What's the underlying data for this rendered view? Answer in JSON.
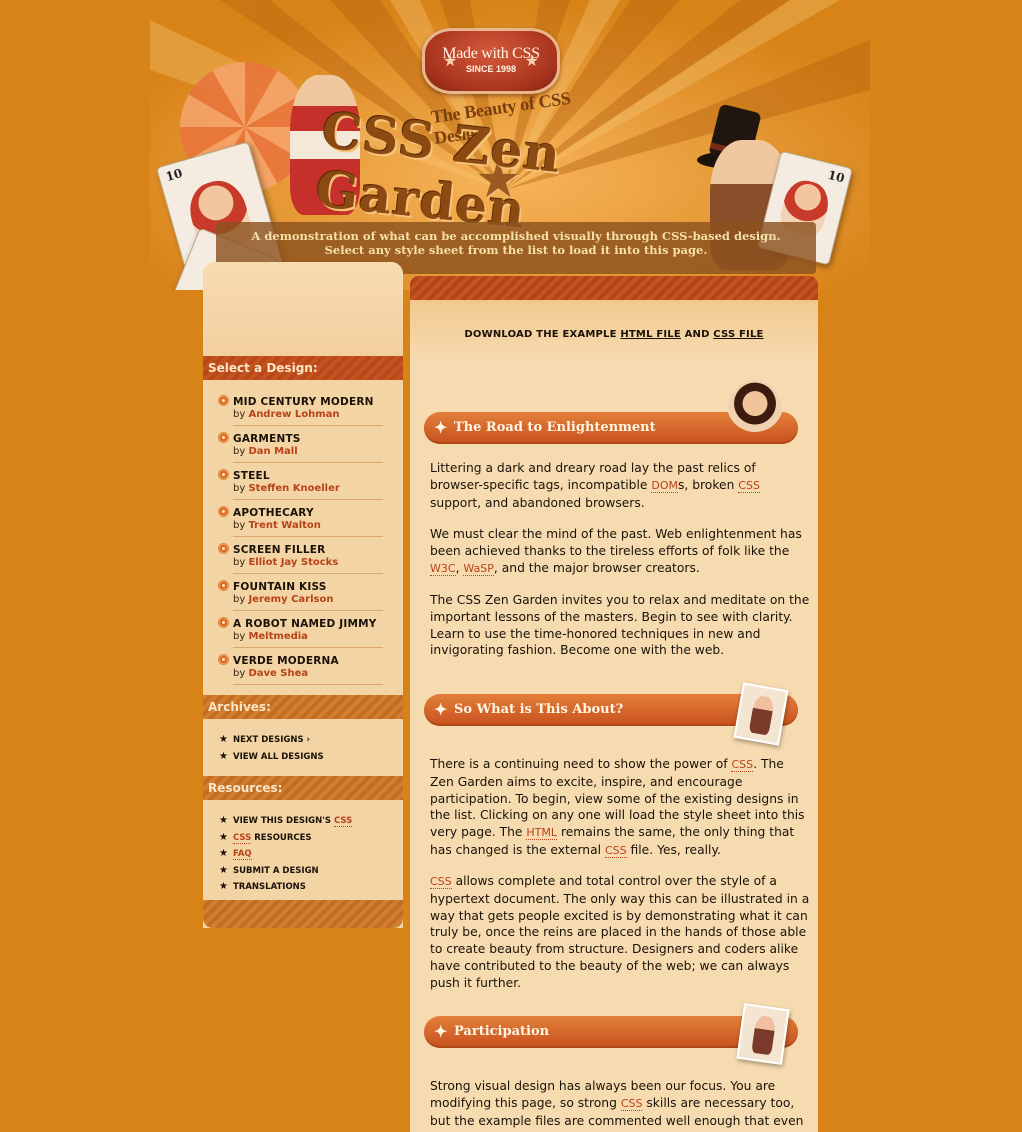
{
  "header": {
    "badge_line1": "Made with CSS",
    "badge_line2": "SINCE 1998",
    "subtitle": "The Beauty of CSS Design",
    "title": "CSS Zen Garden",
    "tagline1": "A demonstration of what can be accomplished visually through CSS-based design.",
    "tagline2": "Select any style sheet from the list to load it into this page."
  },
  "sidebar": {
    "select_heading": "Select a Design:",
    "designs": [
      {
        "name": "MID CENTURY MODERN",
        "by": "by",
        "author": "Andrew Lohman"
      },
      {
        "name": "GARMENTS",
        "by": "by",
        "author": "Dan Mall"
      },
      {
        "name": "STEEL",
        "by": "by",
        "author": "Steffen Knoeller"
      },
      {
        "name": "APOTHECARY",
        "by": "by",
        "author": "Trent Walton"
      },
      {
        "name": "SCREEN FILLER",
        "by": "by",
        "author": "Elliot Jay Stocks"
      },
      {
        "name": "FOUNTAIN KISS",
        "by": "by",
        "author": "Jeremy Carlson"
      },
      {
        "name": "A ROBOT NAMED JIMMY",
        "by": "by",
        "author": "Meltmedia"
      },
      {
        "name": "VERDE MODERNA",
        "by": "by",
        "author": "Dave Shea"
      }
    ],
    "archives_heading": "Archives:",
    "archives": {
      "next": "NEXT DESIGNS ›",
      "all": "VIEW ALL DESIGNS"
    },
    "resources_heading": "Resources:",
    "resources": {
      "view_css_prefix": "VIEW THIS DESIGN'S ",
      "css": "CSS",
      "css_resources_suffix": " RESOURCES",
      "faq": "FAQ",
      "submit": "SUBMIT A DESIGN",
      "translations": "TRANSLATIONS"
    }
  },
  "main": {
    "download": {
      "prefix": "DOWNLOAD THE EXAMPLE ",
      "html_file": "HTML FILE",
      "and": " AND ",
      "css_file": "CSS FILE"
    },
    "sections": [
      {
        "title": "The Road to Enlightenment"
      },
      {
        "title": "So What is This About?"
      },
      {
        "title": "Participation"
      }
    ],
    "road": {
      "p1": {
        "a": "Littering a dark and dreary road lay the past relics of browser-specific tags, incompatible ",
        "dom": "DOM",
        "b": "s, broken ",
        "css": "CSS",
        "c": " support, and abandoned browsers."
      },
      "p2": {
        "a": "We must clear the mind of the past. Web enlightenment has been achieved thanks to the tireless efforts of folk like the ",
        "w3c": "W3C",
        "comma": ", ",
        "wasp": "WaSP",
        "b": ", and the major browser creators."
      },
      "p3": "The CSS Zen Garden invites you to relax and meditate on the important lessons of the masters. Begin to see with clarity. Learn to use the time-honored techniques in new and invigorating fashion. Become one with the web."
    },
    "about": {
      "p1": {
        "a": "There is a continuing need to show the power of ",
        "css": "CSS",
        "b": ". The Zen Garden aims to excite, inspire, and encourage participation. To begin, view some of the existing designs in the list. Clicking on any one will load the style sheet into this very page. The ",
        "html": "HTML",
        "c": " remains the same, the only thing that has changed is the external ",
        "css2": "CSS",
        "d": " file. Yes, really."
      },
      "p2": {
        "css": "CSS",
        "a": " allows complete and total control over the style of a hypertext document. The only way this can be illustrated in a way that gets people excited is by demonstrating what it can truly be, once the reins are placed in the hands of those able to create beauty from structure. Designers and coders alike have contributed to the beauty of the web; we can always push it further."
      }
    },
    "participation": {
      "p1": {
        "a": "Strong visual design has always been our focus. You are modifying this page, so strong ",
        "css": "CSS",
        "b": " skills are necessary too, but the example files are commented well enough that even"
      }
    }
  }
}
